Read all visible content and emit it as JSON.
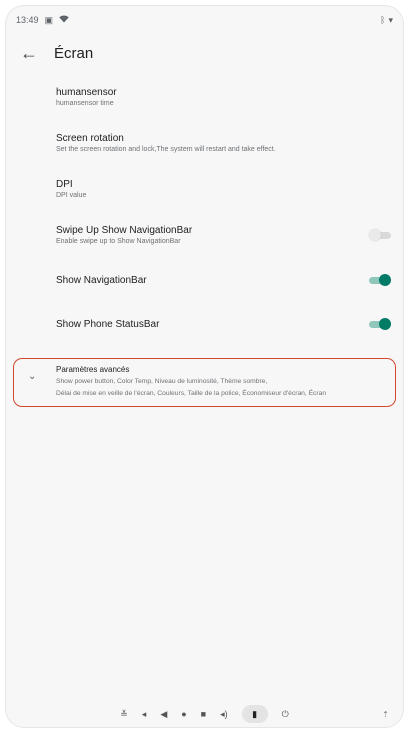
{
  "status_bar": {
    "time": "13:49",
    "right_icons": [
      "bluetooth-icon",
      "signal-icon"
    ]
  },
  "header": {
    "back_icon": "arrow-left-icon",
    "title": "Écran"
  },
  "settings": [
    {
      "title": "humansensor",
      "subtitle": "humansensor time"
    },
    {
      "title": "Screen rotation",
      "subtitle": "Set the screen rotation and lock,The system will restart and take effect."
    },
    {
      "title": "DPI",
      "subtitle": "DPI value"
    },
    {
      "title": "Swipe Up Show NavigationBar",
      "subtitle": "Enable swipe up to Show NavigationBar",
      "toggle": false
    },
    {
      "title": "Show NavigationBar",
      "subtitle": "",
      "toggle": true
    },
    {
      "title": "Show Phone StatusBar",
      "subtitle": "",
      "toggle": true
    }
  ],
  "advanced": {
    "title": "Paramètres avancés",
    "summary_line1": "Show power button, Color Temp, Niveau de luminosité, Thème sombre,",
    "summary_line2": "Délai de mise en veille de l'écran, Couleurs, Taille de la police, Économiseur d'écran, Écran"
  },
  "colors": {
    "accent": "#017a66",
    "highlight_border": "#d1492d"
  },
  "navbar_icons": [
    "collapse-icon",
    "volume-down-icon",
    "back-icon",
    "home-icon",
    "recents-icon",
    "volume-up-icon",
    "screenshot-icon",
    "power-icon",
    "gesture-icon"
  ]
}
